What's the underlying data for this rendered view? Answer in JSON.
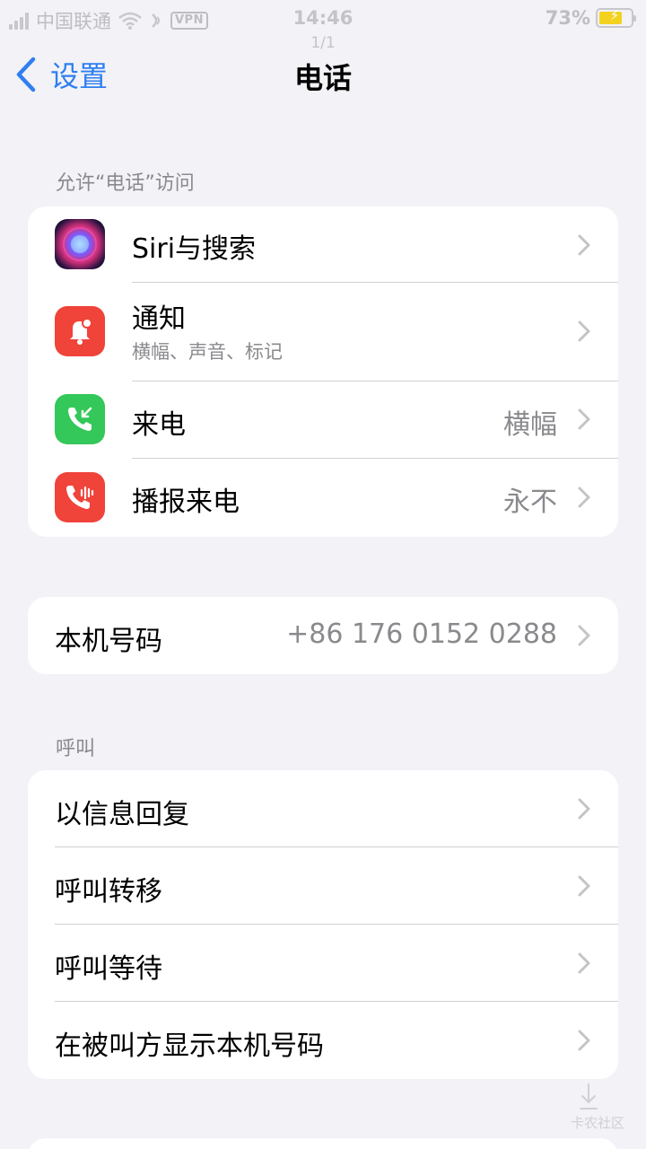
{
  "status_bar": {
    "carrier": "中国联通",
    "vpn": "VPN",
    "time": "14:46",
    "page_indicator": "1/1",
    "battery_percent": "73%",
    "battery_level": 0.73
  },
  "nav": {
    "back_label": "设置",
    "title": "电话"
  },
  "sections": {
    "access_header": "允许“电话”访问",
    "calls_header": "呼叫"
  },
  "access_items": [
    {
      "label": "Siri与搜索",
      "icon": "siri-icon"
    },
    {
      "label": "通知",
      "sub": "横幅、声音、标记",
      "icon": "bell-icon"
    },
    {
      "label": "来电",
      "value": "横幅",
      "icon": "incoming-call-icon"
    },
    {
      "label": "播报来电",
      "value": "永不",
      "icon": "announce-call-icon"
    }
  ],
  "my_number": {
    "label": "本机号码",
    "value": "+86 176 0152 0288"
  },
  "call_items": [
    {
      "label": "以信息回复"
    },
    {
      "label": "呼叫转移"
    },
    {
      "label": "呼叫等待"
    },
    {
      "label": "在被叫方显示本机号码"
    }
  ],
  "watermark": "卡农社区",
  "colors": {
    "accent": "#2f7ff0",
    "background": "#f2f2f7",
    "red": "#f0433a",
    "green": "#34c759"
  }
}
